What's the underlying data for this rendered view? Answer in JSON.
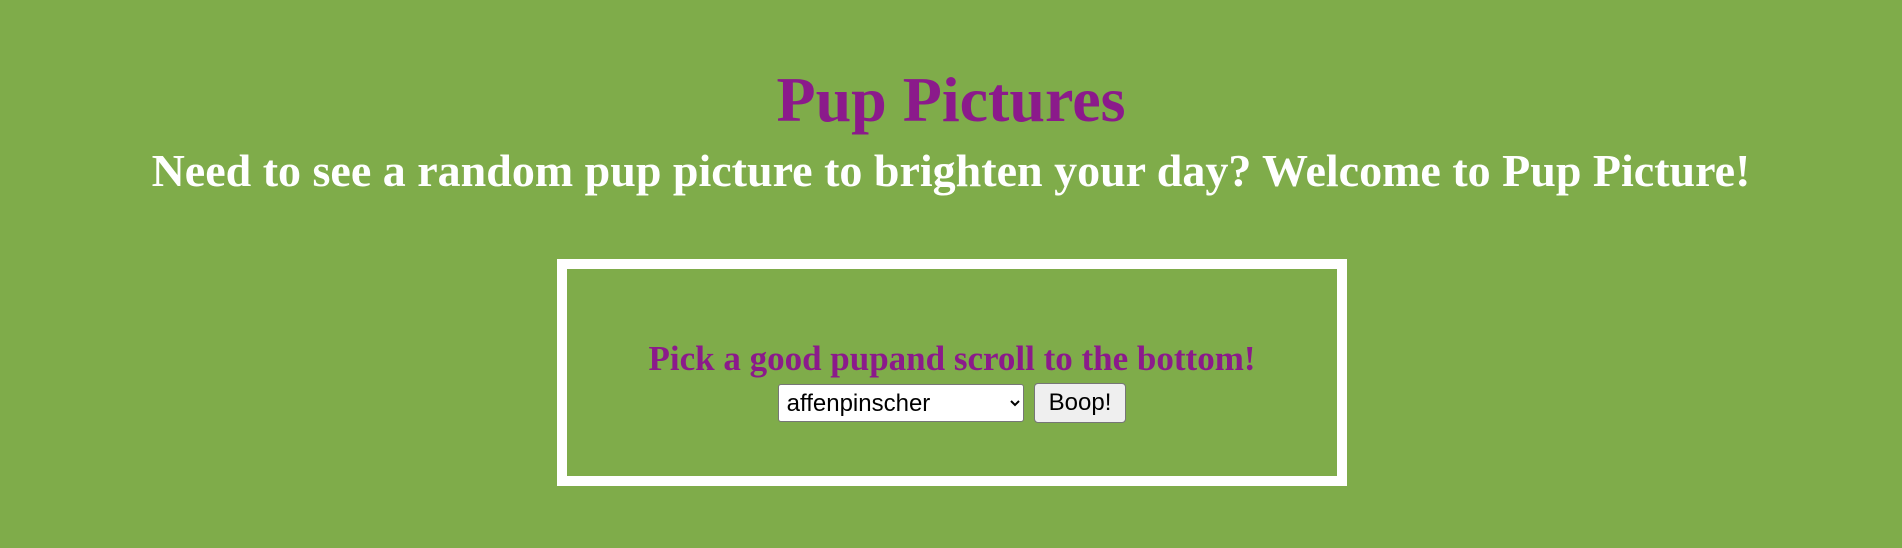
{
  "header": {
    "title": "Pup Pictures",
    "subtitle": "Need to see a random pup picture to brighten your day? Welcome to Pup Picture!"
  },
  "picker": {
    "prompt": "Pick a good pupand scroll to the bottom!",
    "breed_select": {
      "selected": "affenpinscher",
      "options": [
        "affenpinscher"
      ]
    },
    "button_label": "Boop!"
  },
  "colors": {
    "background": "#7fac4a",
    "accent": "#8b1a8b",
    "text_light": "#ffffff"
  }
}
